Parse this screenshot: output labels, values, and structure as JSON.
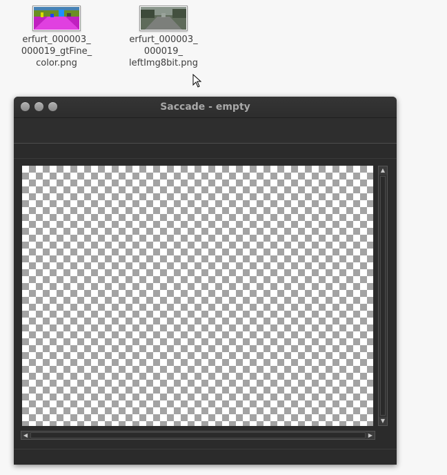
{
  "desktop": {
    "icons": [
      {
        "name": "erfurt_000003_000019_gtFine_color.png",
        "lines": [
          "erfurt_000003_",
          "000019_gtFine_",
          "color.png"
        ]
      },
      {
        "name": "erfurt_000003_000019_leftImg8bit.png",
        "lines": [
          "erfurt_000003_",
          "000019_",
          "leftImg8bit.png"
        ]
      }
    ]
  },
  "window": {
    "title": "Saccade - empty",
    "buttons": [
      "close",
      "minimize",
      "maximize"
    ]
  },
  "scrollbar": {
    "up_glyph": "▲",
    "down_glyph": "▼",
    "left_glyph": "◀",
    "right_glyph": "▶"
  },
  "colors": {
    "window_bg": "#2b2b2b",
    "title_text": "#a8a8a8",
    "checker_dark": "#a3a3a3",
    "checker_light": "#ffffff",
    "desktop_bg": "#f7f7f7"
  }
}
